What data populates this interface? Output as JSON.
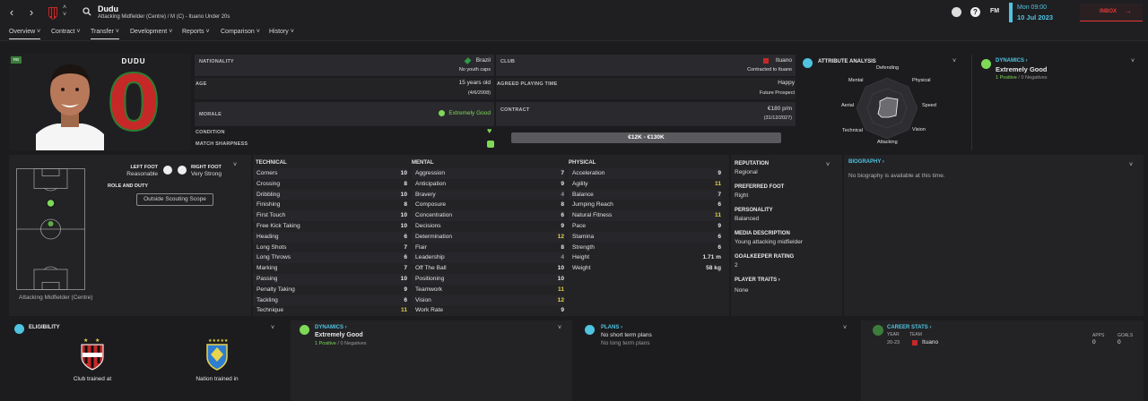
{
  "player": {
    "name": "Dudu",
    "subtitle": "Attacking Midfielder (Centre) / M (C) - Ituano Under 20s",
    "shirt_number": "0",
    "shirt_badge": "RB"
  },
  "header": {
    "time": "Mon 09:00",
    "date": "10 Jul 2023",
    "inbox": "INBOX",
    "fm_label": "FM"
  },
  "tabs": [
    {
      "label": "Overview",
      "active": true
    },
    {
      "label": "Contract"
    },
    {
      "label": "Transfer"
    },
    {
      "label": "Development"
    },
    {
      "label": "Reports"
    },
    {
      "label": "Comparison"
    },
    {
      "label": "History"
    }
  ],
  "info": {
    "nationality_label": "NATIONALITY",
    "nationality": "Brazil",
    "youth_caps": "No youth caps",
    "club_label": "CLUB",
    "club": "Ituano",
    "contracted": "Contracted to Ituano",
    "age_label": "AGE",
    "age": "15 years old",
    "dob": "(4/6/2008)",
    "agreed_label": "AGREED PLAYING TIME",
    "playing_time": "Happy",
    "future": "Future Prospect",
    "morale_label": "MORALE",
    "morale": "Extremely Good",
    "contract_label": "CONTRACT",
    "wage": "€180 p/m",
    "expiry": "(31/12/2027)",
    "condition_label": "CONDITION",
    "sharpness_label": "MATCH SHARPNESS",
    "value_range": "€12K - €130K"
  },
  "attribute_analysis": {
    "title": "ATTRIBUTE ANALYSIS",
    "axes": [
      "Defending",
      "Physical",
      "Speed",
      "Vision",
      "Attacking",
      "Technical",
      "Aerial",
      "Mental"
    ]
  },
  "dynamics": {
    "title": "DYNAMICS",
    "value": "Extremely Good",
    "positives": "1 Positive",
    "sep": "/",
    "negatives": "0 Negatives"
  },
  "feet": {
    "left_label": "LEFT FOOT",
    "left_value": "Reasonable",
    "right_label": "RIGHT FOOT",
    "right_value": "Very Strong"
  },
  "role": {
    "title": "ROLE AND DUTY",
    "button": "Outside Scouting Scope",
    "position": "Attacking Midfielder (Centre)"
  },
  "technical": {
    "title": "TECHNICAL",
    "rows": [
      {
        "name": "Corners",
        "value": "10"
      },
      {
        "name": "Crossing",
        "value": "8"
      },
      {
        "name": "Dribbling",
        "value": "10"
      },
      {
        "name": "Finishing",
        "value": "8"
      },
      {
        "name": "First Touch",
        "value": "10"
      },
      {
        "name": "Free Kick Taking",
        "value": "10"
      },
      {
        "name": "Heading",
        "value": "6"
      },
      {
        "name": "Long Shots",
        "value": "7"
      },
      {
        "name": "Long Throws",
        "value": "6"
      },
      {
        "name": "Marking",
        "value": "7"
      },
      {
        "name": "Passing",
        "value": "10"
      },
      {
        "name": "Penalty Taking",
        "value": "9"
      },
      {
        "name": "Tackling",
        "value": "6"
      },
      {
        "name": "Technique",
        "value": "11"
      }
    ]
  },
  "mental": {
    "title": "MENTAL",
    "rows": [
      {
        "name": "Aggression",
        "value": "7"
      },
      {
        "name": "Anticipation",
        "value": "9"
      },
      {
        "name": "Bravery",
        "value": "4"
      },
      {
        "name": "Composure",
        "value": "8"
      },
      {
        "name": "Concentration",
        "value": "6"
      },
      {
        "name": "Decisions",
        "value": "9"
      },
      {
        "name": "Determination",
        "value": "12"
      },
      {
        "name": "Flair",
        "value": "8"
      },
      {
        "name": "Leadership",
        "value": "4"
      },
      {
        "name": "Off The Ball",
        "value": "10"
      },
      {
        "name": "Positioning",
        "value": "10"
      },
      {
        "name": "Teamwork",
        "value": "11"
      },
      {
        "name": "Vision",
        "value": "12"
      },
      {
        "name": "Work Rate",
        "value": "9"
      }
    ]
  },
  "physical": {
    "title": "PHYSICAL",
    "rows": [
      {
        "name": "Acceleration",
        "value": "9"
      },
      {
        "name": "Agility",
        "value": "11"
      },
      {
        "name": "Balance",
        "value": "7"
      },
      {
        "name": "Jumping Reach",
        "value": "6"
      },
      {
        "name": "Natural Fitness",
        "value": "11"
      },
      {
        "name": "Pace",
        "value": "9"
      },
      {
        "name": "Stamina",
        "value": "6"
      },
      {
        "name": "Strength",
        "value": "6"
      }
    ],
    "height_label": "Height",
    "height": "1.71 m",
    "weight_label": "Weight",
    "weight": "58 kg"
  },
  "profile": {
    "reputation_label": "REPUTATION",
    "reputation": "Regional",
    "foot_label": "PREFERRED FOOT",
    "foot": "Right",
    "personality_label": "PERSONALITY",
    "personality": "Balanced",
    "media_label": "MEDIA DESCRIPTION",
    "media": "Young attacking midfielder",
    "gk_label": "GOALKEEPER RATING",
    "gk": "2",
    "traits_label": "PLAYER TRAITS",
    "traits": "None"
  },
  "biography": {
    "title": "BIOGRAPHY",
    "text": "No biography is available at this time."
  },
  "eligibility": {
    "title": "ELIGIBILITY",
    "club_caption": "Club trained at",
    "nation_caption": "Nation trained in"
  },
  "plans": {
    "title": "PLANS",
    "short": "No short term plans",
    "long": "No long term plans"
  },
  "career": {
    "title": "CAREER STATS",
    "year_h": "YEAR",
    "team_h": "TEAM",
    "apps_h": "APPS",
    "goals_h": "GOALS",
    "year": "20-23",
    "team": "Ituano",
    "apps": "0",
    "goals": "0"
  },
  "colors": {
    "accent": "#4fc3e0",
    "positive": "#7ed957",
    "highlight": "#e8d44d",
    "inbox": "#e53935"
  }
}
